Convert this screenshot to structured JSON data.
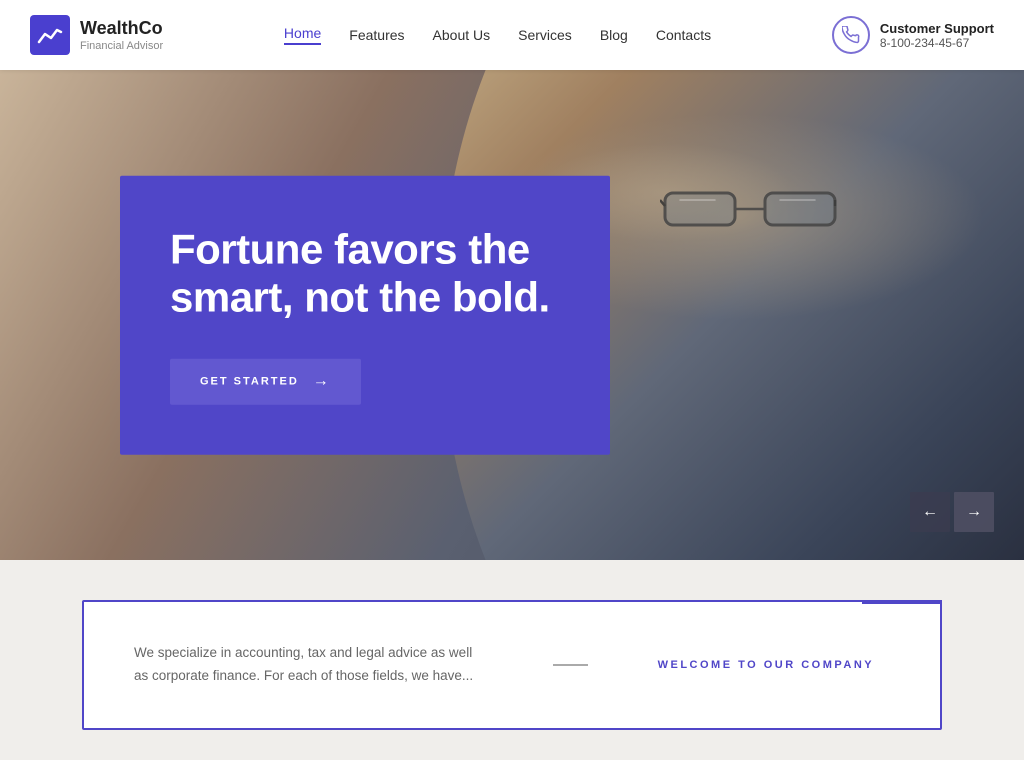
{
  "header": {
    "logo": {
      "title": "WealthCo",
      "subtitle": "Financial Advisor"
    },
    "nav": [
      {
        "label": "Home",
        "active": true
      },
      {
        "label": "Features",
        "active": false
      },
      {
        "label": "About Us",
        "active": false
      },
      {
        "label": "Services",
        "active": false
      },
      {
        "label": "Blog",
        "active": false
      },
      {
        "label": "Contacts",
        "active": false
      }
    ],
    "support": {
      "label": "Customer Support",
      "phone": "8-100-234-45-67"
    }
  },
  "hero": {
    "headline": "Fortune favors the smart, not the bold.",
    "cta_label": "GET STARTED"
  },
  "slider": {
    "prev_arrow": "←",
    "next_arrow": "→"
  },
  "below_hero": {
    "description": "We specialize in accounting, tax and legal advice as well as corporate finance. For each of those fields, we have...",
    "welcome_label": "WELCOME TO OUR COMPANY"
  }
}
